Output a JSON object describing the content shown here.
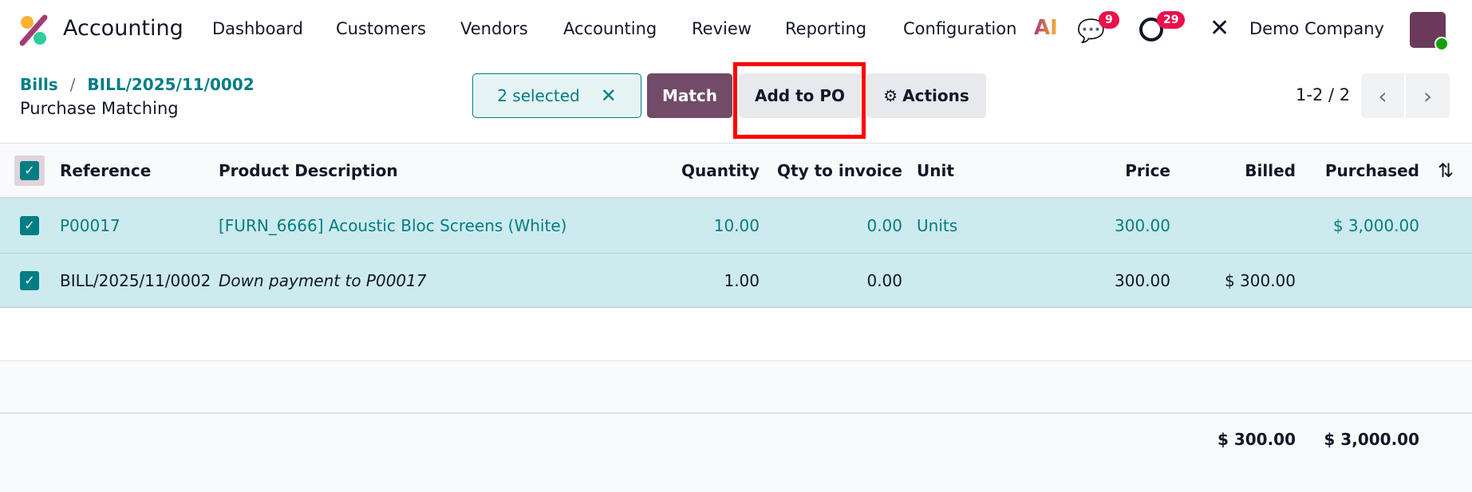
{
  "app": {
    "name": "Accounting",
    "menu": [
      "Dashboard",
      "Customers",
      "Vendors",
      "Accounting",
      "Review",
      "Reporting",
      "Configuration"
    ],
    "messages_count": "9",
    "activities_count": "29",
    "company": "Demo Company"
  },
  "breadcrumb": {
    "parent": "Bills",
    "record": "BILL/2025/11/0002",
    "title": "Purchase Matching"
  },
  "toolbar": {
    "selected": "2 selected",
    "match": "Match",
    "add_to_po": "Add to PO",
    "actions": "Actions",
    "pager": "1-2 / 2"
  },
  "table": {
    "headers": [
      "Reference",
      "Product Description",
      "Quantity",
      "Qty to invoice",
      "Unit",
      "Price",
      "Billed",
      "Purchased"
    ],
    "rows": [
      {
        "reference": "P00017",
        "description": "[FURN_6666] Acoustic Bloc Screens (White)",
        "quantity": "10.00",
        "qty_to_invoice": "0.00",
        "unit": "Units",
        "price": "300.00",
        "billed": "",
        "purchased": "$ 3,000.00"
      },
      {
        "reference": "BILL/2025/11/0002",
        "description": "Down payment to P00017",
        "quantity": "1.00",
        "qty_to_invoice": "0.00",
        "unit": "",
        "price": "300.00",
        "billed": "$ 300.00",
        "purchased": ""
      }
    ],
    "totals": {
      "billed": "$ 300.00",
      "purchased": "$ 3,000.00"
    }
  },
  "colors": {
    "accent": "#017e84",
    "match": "#714b67",
    "highlight": "#ff0000"
  }
}
